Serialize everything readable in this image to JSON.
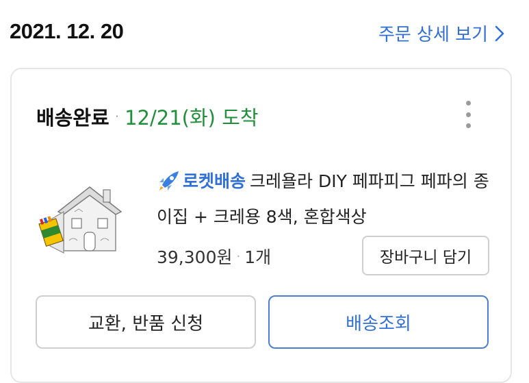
{
  "order": {
    "date": "2021. 12. 20",
    "detail_link_label": "주문 상세 보기"
  },
  "delivery": {
    "status": "배송완료",
    "separator": "·",
    "arrival": "12/21(화) 도착"
  },
  "product": {
    "rocket_label": "로켓배송",
    "name": "크레욜라 DIY 페파피그 페파의 종이집 + 크레용 8색, 혼합색상",
    "price": "39,300원",
    "separator": "·",
    "quantity": "1개",
    "thumbnail_icon": "paper-house-product-image"
  },
  "buttons": {
    "add_to_cart": "장바구니 담기",
    "exchange_return": "교환, 반품 신청",
    "track_delivery": "배송조회"
  },
  "colors": {
    "link_blue": "#2f6fd6",
    "arrival_green": "#1f8f3a"
  }
}
